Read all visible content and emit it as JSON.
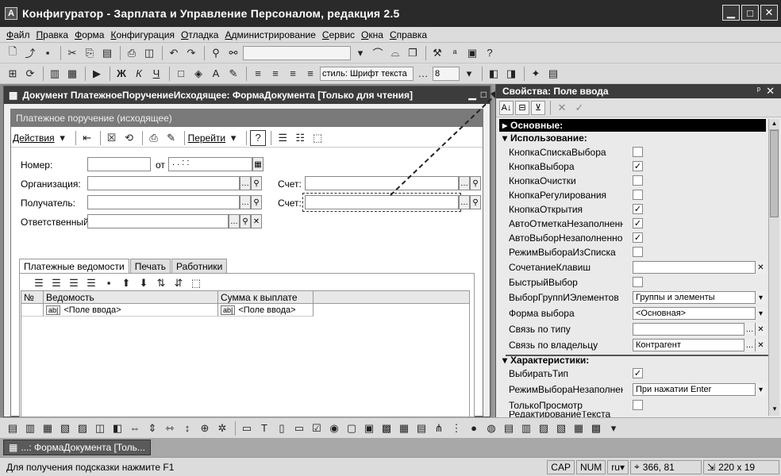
{
  "app": {
    "title": "Конфигуратор - Зарплата и Управление Персоналом, редакция 2.5",
    "icon_name": "app-1c-icon"
  },
  "menu": [
    "Файл",
    "Правка",
    "Форма",
    "Конфигурация",
    "Отладка",
    "Администрирование",
    "Сервис",
    "Окна",
    "Справка"
  ],
  "toolbar2": {
    "style_value": "стиль: Шрифт текста",
    "size_value": "8",
    "bold": "Ж",
    "italic": "К",
    "underline": "Ч"
  },
  "doc_window": {
    "title": "Документ ПлатежноеПоручениеИсходящее: ФормаДокумента [Только для чтения]"
  },
  "form": {
    "header": "Платежное поручение (исходящее)",
    "actions_label": "Действия",
    "goto_label": "Перейти",
    "number_label": "Номер:",
    "from_label": "от",
    "date_placeholder": ". .   : :",
    "org_label": "Организация:",
    "account_label": "Счет:",
    "recipient_label": "Получатель:",
    "account2_label": "Счет:",
    "responsible_label": "Ответственный:",
    "tabs": [
      "Платежные ведомости",
      "Печать",
      "Работники"
    ],
    "grid": {
      "columns": [
        "№",
        "Ведомость",
        "Сумма к выплате"
      ],
      "rows": [
        [
          "",
          "<Поле ввода>",
          "<Поле ввода>"
        ]
      ]
    }
  },
  "properties": {
    "title": "Свойства: Поле ввода",
    "group_main": "Основные:",
    "group_usage": "Использование:",
    "group_chars": "Характеристики:",
    "usage_rows": [
      {
        "label": "КнопкаСпискаВыбора",
        "checked": false
      },
      {
        "label": "КнопкаВыбора",
        "checked": true
      },
      {
        "label": "КнопкаОчистки",
        "checked": false
      },
      {
        "label": "КнопкаРегулирования",
        "checked": false
      },
      {
        "label": "КнопкаОткрытия",
        "checked": true
      },
      {
        "label": "АвтоОтметкаНезаполненного",
        "checked": true
      },
      {
        "label": "АвтоВыборНезаполненного",
        "checked": true
      },
      {
        "label": "РежимВыбораИзСписка",
        "checked": false
      }
    ],
    "hotkey_label": "СочетаниеКлавиш",
    "quick_label": "БыстрыйВыбор",
    "groups_label": "ВыборГруппИЭлементов",
    "groups_value": "Группы и элементы",
    "choiceform_label": "Форма выбора",
    "choiceform_value": "<Основная>",
    "typelink_label": "Связь по типу",
    "ownerlink_label": "Связь по владельцу",
    "ownerlink_value": "Контрагент",
    "choose_type_label": "ВыбиратьТип",
    "mode_unfilled_label": "РежимВыбораНезаполненного",
    "mode_unfilled_value": "При нажатии Enter",
    "readonly_label": "ТолькоПросмотр",
    "last_label": "РедактированиеТекста"
  },
  "taskbar": {
    "item": "...: ФормаДокумента [Толь..."
  },
  "status": {
    "hint": "Для получения подсказки нажмите F1",
    "cap": "CAP",
    "num": "NUM",
    "lang": "ru",
    "coords": "366, 81",
    "size": "220 x 19"
  }
}
